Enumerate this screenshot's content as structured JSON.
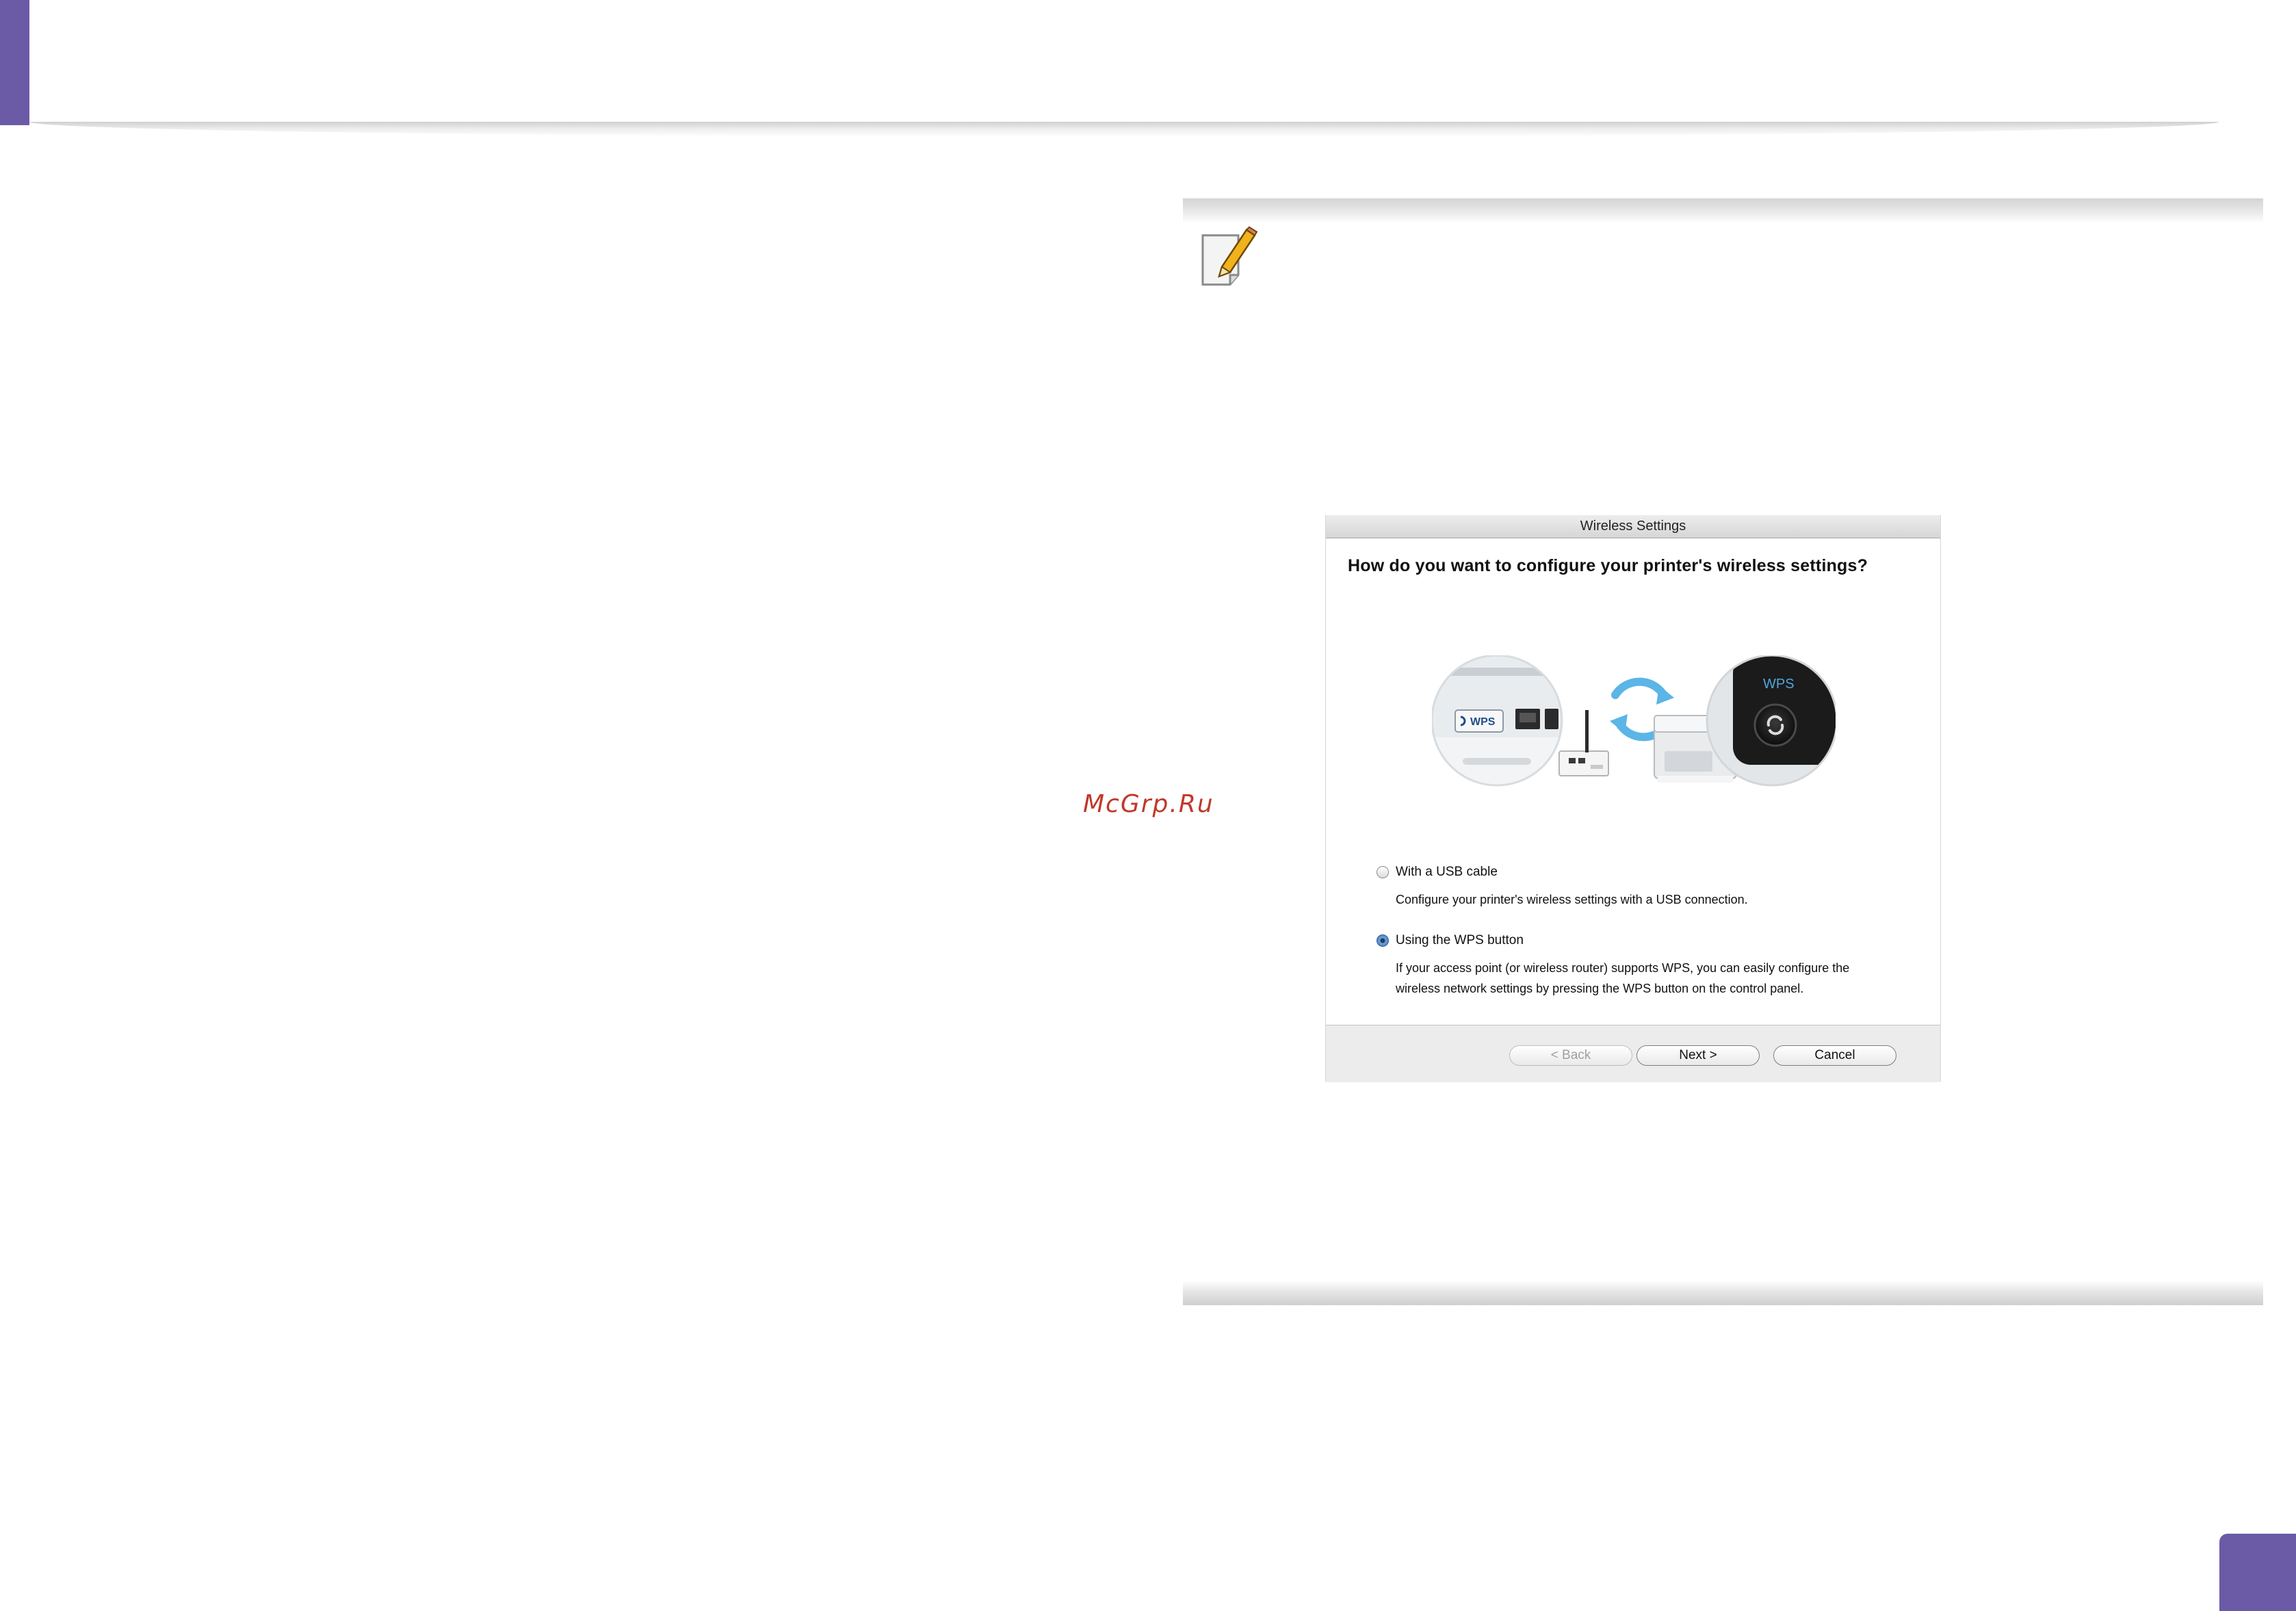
{
  "watermark": {
    "text": "McGrp.Ru"
  },
  "note": {
    "icon": "note-pencil-icon"
  },
  "dialog": {
    "title": "Wireless Settings",
    "question": "How do you want to configure your printer's wireless settings?",
    "illustration": {
      "wps_label": "WPS",
      "wps_panel_label": "WPS"
    },
    "options": [
      {
        "label": "With a USB cable",
        "description": "Configure your printer's wireless settings with a USB connection.",
        "selected": false
      },
      {
        "label": "Using the WPS button",
        "description": "If your access point (or wireless router) supports WPS, you can easily configure the wireless network settings by pressing the WPS button on the control panel.",
        "selected": true
      }
    ],
    "buttons": {
      "back": "< Back",
      "next": "Next >",
      "cancel": "Cancel"
    }
  },
  "colors": {
    "accent": "#6b5aa6",
    "watermark": "#c0392b"
  }
}
